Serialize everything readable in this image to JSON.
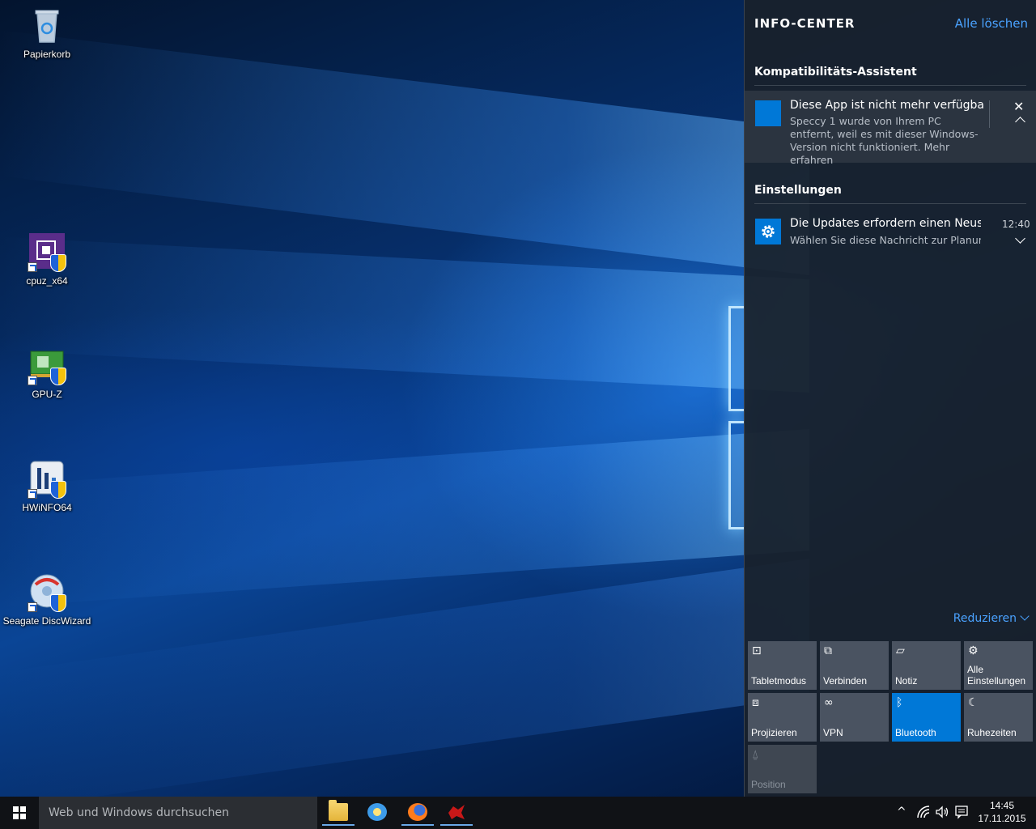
{
  "desktop": {
    "icons": [
      {
        "label": "Papierkorb",
        "icon": "recycle-bin-icon"
      },
      {
        "label": "cpuz_x64",
        "icon": "cpuz-icon"
      },
      {
        "label": "GPU-Z",
        "icon": "gpuz-icon"
      },
      {
        "label": "HWiNFO64",
        "icon": "hwinfo-icon"
      },
      {
        "label": "Seagate DiscWizard",
        "icon": "discwizard-icon"
      }
    ]
  },
  "action_center": {
    "title": "INFO-CENTER",
    "clear_all": "Alle löschen",
    "groups": [
      {
        "name": "Kompatibilitäts-Assistent",
        "notification": {
          "title": "Diese App ist nicht mehr verfügbar.",
          "body": "Speccy 1 wurde von Ihrem PC entfernt, weil es mit dieser Windows-Version nicht funktioniert. Mehr erfahren",
          "close": "✕"
        }
      },
      {
        "name": "Einstellungen",
        "notification": {
          "title": "Die Updates erfordern einen Neustart",
          "body": "Wählen Sie diese Nachricht zur Planung aus",
          "time": "12:40"
        }
      }
    ],
    "collapse_label": "Reduzieren",
    "quick_actions": [
      {
        "label": "Tabletmodus",
        "icon": "tablet-mode-icon",
        "glyph": "⊡",
        "state": "off"
      },
      {
        "label": "Verbinden",
        "icon": "connect-icon",
        "glyph": "⧉",
        "state": "off"
      },
      {
        "label": "Notiz",
        "icon": "note-icon",
        "glyph": "▱",
        "state": "off"
      },
      {
        "label": "Alle Einstellungen",
        "icon": "settings-gear-icon",
        "glyph": "⚙",
        "state": "off"
      },
      {
        "label": "Projizieren",
        "icon": "project-icon",
        "glyph": "⧈",
        "state": "off"
      },
      {
        "label": "VPN",
        "icon": "vpn-icon",
        "glyph": "∞",
        "state": "off"
      },
      {
        "label": "Bluetooth",
        "icon": "bluetooth-icon",
        "glyph": "ᛒ",
        "state": "on"
      },
      {
        "label": "Ruhezeiten",
        "icon": "quiet-hours-moon-icon",
        "glyph": "☾",
        "state": "off"
      },
      {
        "label": "Position",
        "icon": "location-icon",
        "glyph": "⍙",
        "state": "disabled"
      }
    ],
    "colors": {
      "accent": "#0078d7",
      "link": "#4aa2ff",
      "panel": "#18212c"
    }
  },
  "taskbar": {
    "search_placeholder": "Web und Windows durchsuchen",
    "apps": [
      {
        "name": "file-explorer-icon"
      },
      {
        "name": "app-sun-icon"
      },
      {
        "name": "firefox-icon"
      },
      {
        "name": "app-red-icon"
      }
    ],
    "tray": {
      "chevron": "^",
      "time": "14:45",
      "date": "17.11.2015"
    }
  }
}
